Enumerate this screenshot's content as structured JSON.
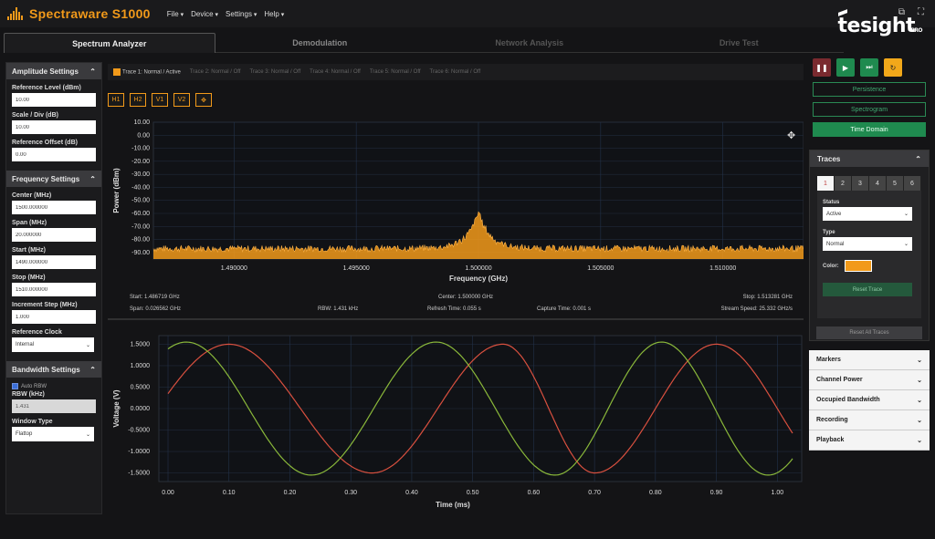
{
  "app": {
    "title": "Spectraware S1000",
    "menu": [
      "File",
      "Device",
      "Settings",
      "Help"
    ],
    "brand": "tesight",
    "brand_sub": "PRO"
  },
  "tabs": [
    {
      "label": "Spectrum Analyzer",
      "active": true
    },
    {
      "label": "Demodulation",
      "active": false
    },
    {
      "label": "Network Analysis",
      "active": false
    },
    {
      "label": "Drive Test",
      "active": false
    }
  ],
  "amplitude": {
    "title": "Amplitude Settings",
    "reference_level_label": "Reference Level (dBm)",
    "reference_level": "10.00",
    "scale_label": "Scale / Div (dB)",
    "scale": "10.00",
    "offset_label": "Reference Offset (dB)",
    "offset": "0.00"
  },
  "frequency": {
    "title": "Frequency Settings",
    "center_label": "Center (MHz)",
    "center": "1500.000000",
    "span_label": "Span (MHz)",
    "span": "20.000000",
    "start_label": "Start (MHz)",
    "start": "1490.000000",
    "stop_label": "Stop (MHz)",
    "stop": "1510.000000",
    "step_label": "Increment Step (MHz)",
    "step": "1.000",
    "clock_label": "Reference Clock",
    "clock": "Internal"
  },
  "bandwidth": {
    "title": "Bandwidth Settings",
    "auto_rbw_label": "Auto RBW",
    "rbw_label": "RBW (kHz)",
    "rbw": "1.431",
    "window_label": "Window Type",
    "window": "Flattop"
  },
  "trace_bar": [
    {
      "label": "Trace 1: Normal / Active",
      "active": true
    },
    {
      "label": "Trace 2: Normal / Off",
      "active": false
    },
    {
      "label": "Trace 3: Normal / Off",
      "active": false
    },
    {
      "label": "Trace 4: Normal / Off",
      "active": false
    },
    {
      "label": "Trace 5: Normal / Off",
      "active": false
    },
    {
      "label": "Trace 6: Normal / Off",
      "active": false
    }
  ],
  "marker_buttons": [
    "H1",
    "H2",
    "V1",
    "V2",
    "✥"
  ],
  "spectrum_info": {
    "start": "Start: 1.486719 GHz",
    "span": "Span: 0.026562 GHz",
    "rbw": "RBW: 1.431 kHz",
    "center": "Center: 1.500000 GHz",
    "refresh": "Refresh Time: 0.055 s",
    "capture": "Capture Time: 0.001 s",
    "stop": "Stop: 1.513281 GHz",
    "stream": "Stream Speed: 25.332 GHz/s"
  },
  "right_panel": {
    "persistence": "Persistence",
    "spectrogram": "Spectrogram",
    "time_domain": "Time Domain",
    "traces_title": "Traces",
    "trace_tabs": [
      "1",
      "2",
      "3",
      "4",
      "5",
      "6"
    ],
    "status_label": "Status",
    "status": "Active",
    "type_label": "Type",
    "type": "Normal",
    "color_label": "Color:",
    "reset_trace": "Reset Trace",
    "reset_all": "Reset All Traces",
    "sections": [
      "Markers",
      "Channel Power",
      "Occupied Bandwidth",
      "Recording",
      "Playback"
    ]
  },
  "colors": {
    "accent": "#f29a1a",
    "green": "#1f8a4f",
    "trace_red": "#d9503f",
    "trace_green": "#8ab83a"
  },
  "chart_data": [
    {
      "type": "area",
      "ylabel": "Power (dBm)",
      "xlabel": "Frequency (GHz)",
      "x_ticks": [
        "1.490000",
        "1.495000",
        "1.500000",
        "1.505000",
        "1.510000"
      ],
      "y_ticks": [
        "10.00",
        "0.00",
        "-10.00",
        "-20.00",
        "-30.00",
        "-40.00",
        "-50.00",
        "-60.00",
        "-70.00",
        "-80.00",
        "-90.00"
      ],
      "xlim": [
        1.4867,
        1.5133
      ],
      "ylim": [
        -95,
        10
      ],
      "noise_floor": -87,
      "peak": {
        "x": 1.5,
        "y": -60
      }
    },
    {
      "type": "line",
      "ylabel": "Voltage (V)",
      "xlabel": "Time (ms)",
      "x_ticks": [
        "0.00",
        "0.10",
        "0.20",
        "0.30",
        "0.40",
        "0.50",
        "0.60",
        "0.70",
        "0.80",
        "0.90",
        "1.00"
      ],
      "y_ticks": [
        "1.5000",
        "1.0000",
        "0.5000",
        "0.0000",
        "-0.5000",
        "-1.0000",
        "-1.5000"
      ],
      "xlim": [
        -0.015,
        1.04
      ],
      "ylim": [
        -1.7,
        1.7
      ],
      "series": [
        {
          "amplitude": 1.5,
          "peaks_at_ms": [
            0.1,
            0.55,
            0.9
          ],
          "troughs_at_ms": [
            0.335,
            0.7
          ],
          "color": "#d9503f"
        },
        {
          "amplitude": 1.55,
          "peaks_at_ms": [
            0.44,
            0.81
          ],
          "troughs_at_ms": [
            0.235,
            0.635
          ],
          "color": "#8ab83a"
        }
      ]
    }
  ]
}
